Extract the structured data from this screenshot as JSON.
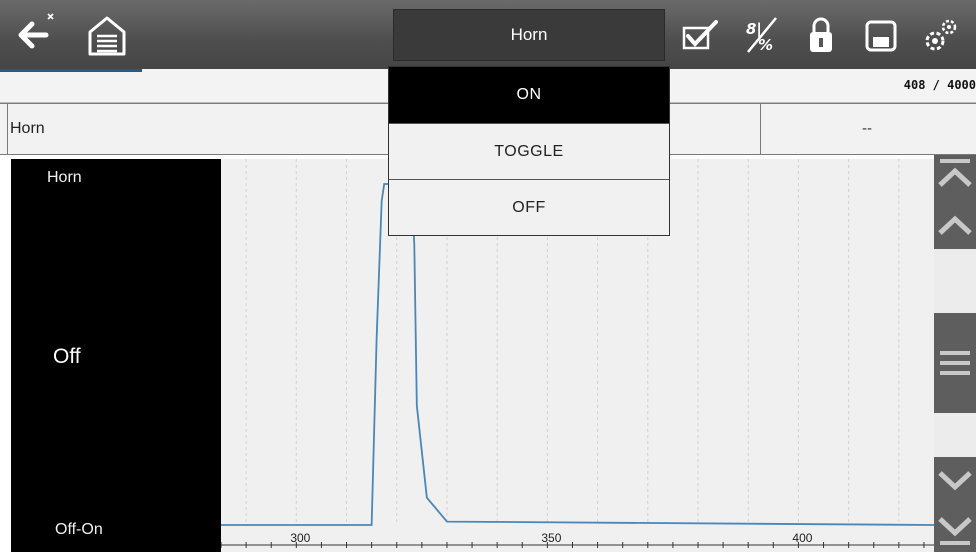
{
  "toolbar": {
    "title": "Horn",
    "icons": [
      "back-arrow-icon",
      "home-garage-icon",
      "check-clipboard-icon",
      "data-toggle-icon",
      "lock-icon",
      "save-icon",
      "settings-gears-icon"
    ]
  },
  "progress": {
    "count_text": "408 / 4000",
    "fraction": 0.145
  },
  "pid_row": {
    "name": "Horn",
    "value": "--"
  },
  "graph": {
    "title": "Horn",
    "current_value": "Off",
    "scale_label": "Off-On",
    "line_color": "#4a86b8"
  },
  "chart_data": {
    "type": "line",
    "x_tick_labels": [
      "300",
      "350",
      "400"
    ],
    "xlim": [
      285,
      427
    ],
    "ylim": [
      0,
      1
    ],
    "series": [
      {
        "x": [
          285,
          315,
          316,
          317,
          317.5,
          323,
          323.5,
          324,
          326,
          330,
          427
        ],
        "values": [
          0,
          0,
          0.55,
          0.95,
          1,
          1,
          0.82,
          0.35,
          0.08,
          0.01,
          0
        ]
      }
    ]
  },
  "dropdown": {
    "options": [
      {
        "label": "ON",
        "selected": true
      },
      {
        "label": "TOGGLE",
        "selected": false
      },
      {
        "label": "OFF",
        "selected": false
      }
    ]
  },
  "colors": {
    "toolbar": "#555555",
    "progress": "#1e5d8c",
    "selected_option": "#000000"
  }
}
